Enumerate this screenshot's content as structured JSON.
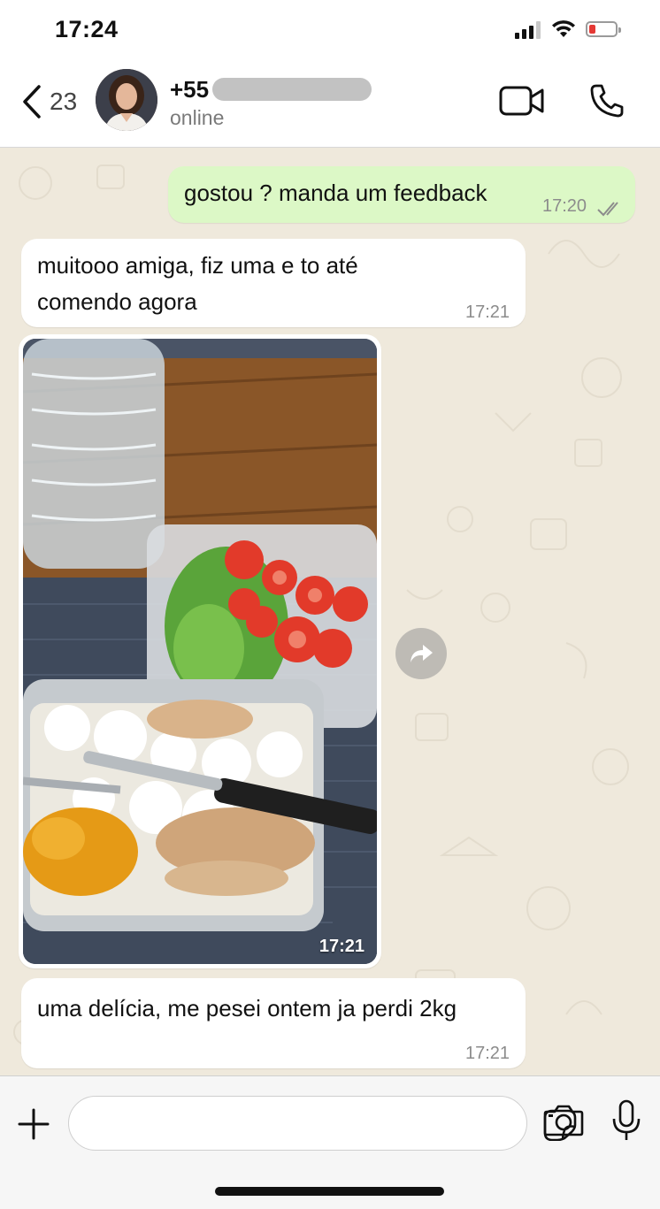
{
  "status": {
    "time": "17:24"
  },
  "header": {
    "back_count": "23",
    "contact_name": "+55",
    "contact_status": "online"
  },
  "messages": [
    {
      "direction": "out",
      "text": "gostou ? manda um feedback",
      "time": "17:20",
      "read": true
    },
    {
      "direction": "in",
      "text": "muitooo amiga, fiz uma e to até comendo agora",
      "time": "17:21"
    },
    {
      "direction": "in",
      "type": "image",
      "time": "17:21"
    },
    {
      "direction": "in",
      "text": "uma delícia, me pesei ontem ja perdi 2kg",
      "time": "17:21"
    }
  ],
  "composer": {
    "placeholder": ""
  },
  "icons": {
    "back": "chevron-left-icon",
    "video": "video-camera-icon",
    "call": "phone-icon",
    "forward": "forward-icon",
    "plus": "plus-icon",
    "sticker": "sticker-icon",
    "camera": "camera-icon",
    "mic": "microphone-icon"
  },
  "colors": {
    "outgoing_bubble": "#dcf8c6",
    "incoming_bubble": "#ffffff",
    "chat_background": "#efe9dc",
    "battery_low": "#e53935"
  }
}
